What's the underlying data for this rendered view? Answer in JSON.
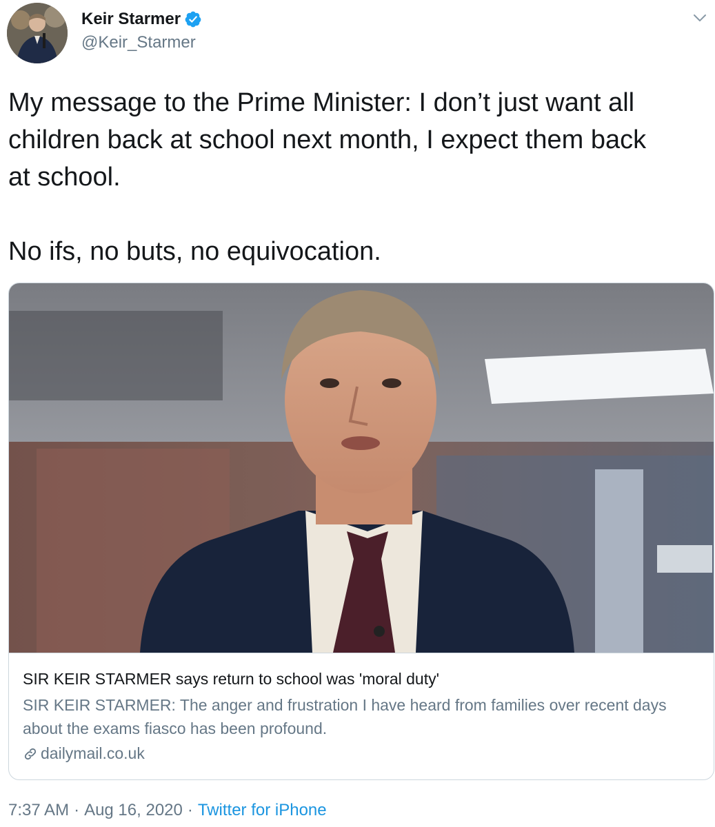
{
  "author": {
    "display_name": "Keir Starmer",
    "handle": "@Keir_Starmer",
    "verified": true,
    "verified_color": "#1da1f2"
  },
  "tweet": {
    "text": "My message to the Prime Minister: I don’t just want all\nchildren back at school next month, I expect them back\nat school.\n\nNo ifs, no buts, no equivocation."
  },
  "card": {
    "title": "SIR KEIR STARMER says return to school was 'moral duty'",
    "description": "SIR KEIR STARMER: The anger and frustration I have heard from families over recent days about the exams fiasco has been profound.",
    "domain": "dailymail.co.uk",
    "icon": "link-icon"
  },
  "meta": {
    "time": "7:37 AM",
    "separator": "·",
    "date": "Aug 16, 2020",
    "source": "Twitter for iPhone",
    "source_color": "#1b95e0"
  },
  "icons": [
    "verified-icon",
    "chevron-down-icon",
    "link-icon"
  ]
}
